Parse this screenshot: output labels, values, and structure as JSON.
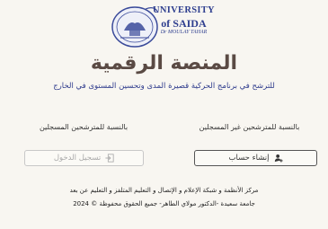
{
  "logo": {
    "line1": "UNIVERSITY",
    "line2": "of SAIDA",
    "line3": "Dr MOULAY TAHAR"
  },
  "title": "المنصة الرقمية",
  "subtitle": "للترشح في برنامج الحركية قصيرة المدى وتحسين المستوى في الخارج",
  "unregistered_label": "بالنسبة للمترشحين غير المسجلين",
  "registered_label": "بالنسبة للمترشحين المسجلين",
  "create_account_button": {
    "label": "إنشاء حساب",
    "icon": "user-add-icon"
  },
  "login_button": {
    "label": "تسجيل الدخول",
    "icon": "login-icon",
    "state": "disabled"
  },
  "footer": {
    "line1": "مركز الأنظمة و شبكة الإعلام و الإتصال و التعليم المتلفز و التعليم عن بعد",
    "line2": "جامعة سعيدة -الدكتور مولاي الطاهر- جميع الحقوق محفوظة © 2024"
  },
  "colors": {
    "title": "#5a4a44",
    "subtitle": "#2d3a8c",
    "logo": "#2f3f8f"
  }
}
